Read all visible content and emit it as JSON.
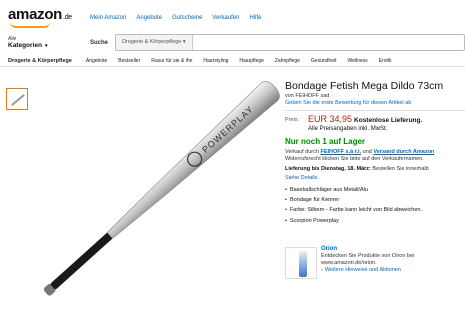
{
  "header": {
    "logo": "amazon",
    "logo_suffix": ".de",
    "nav": [
      "Mein Amazon",
      "Angebote",
      "Gutscheine",
      "Verkaufen",
      "Hilfe"
    ],
    "category_small": "Alle",
    "category_big": "Kategorien",
    "search_label": "Suche",
    "search_dropdown": "Drogerie & Körperpflege"
  },
  "subnav": {
    "first": "Drogerie & Körperpflege",
    "items": [
      "Angebote",
      "Bestseller",
      "Rasur für sie & ihn",
      "Haarstyling",
      "Haarpflege",
      "Zahnpflege",
      "Gesundheit",
      "Wellness",
      "Erotik"
    ]
  },
  "product": {
    "title": "Bondage Fetish Mega Dildo 73cm",
    "by": "von FEIHOFF sad",
    "review_link": "Geben Sie die erste Bewertung für diesen Artikel ab",
    "price_label": "Preis:",
    "price": "EUR 34,95",
    "shipping": "Kostenlose Lieferung.",
    "price_note": "Alle Preisangaben inkl. MwSt.",
    "stock": "Nur noch 1 auf Lager",
    "seller_prefix": "Verkauf durch",
    "seller": "FEIHOFF s.à r.l.",
    "shipping_prefix": "und",
    "shipping_by": "Versand durch Amazon",
    "returns": "Widerrufsrecht klicken Sie bitte auf den Verkäufernamen.",
    "delivery": "Lieferung bis Dienstag, 18. März:",
    "delivery_rest": "Bestellen Sie innerhalb",
    "details_link": "Siehe Details.",
    "bullets": [
      "Baseballschläger aus Metall/Alu",
      "Bondage für Kenner",
      "Farbe: Silbern - Farbe kann leicht von Bild abweichen.",
      "Scorpion Powerplay"
    ],
    "bat_text": "POWERPLAY"
  },
  "brand_box": {
    "name": "Orion",
    "line1": "Entdecken Sie Produkte von Orion bei",
    "line2": "www.amazon.de/orion.",
    "link": "Weitere Hinweise und Aktionen"
  }
}
